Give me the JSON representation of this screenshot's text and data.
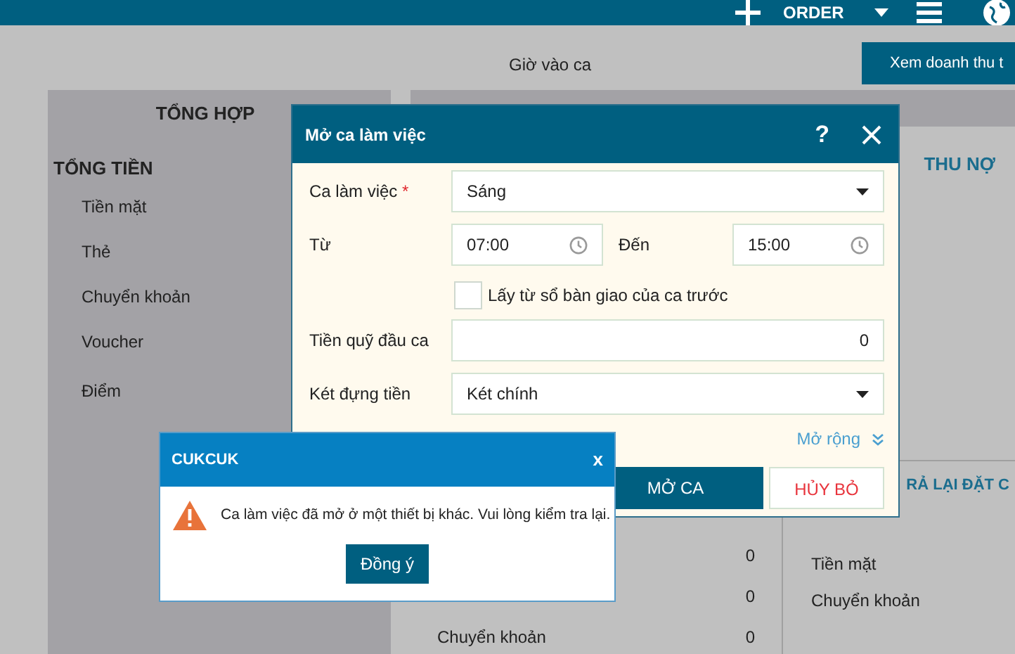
{
  "header": {
    "order_label": "ORDER"
  },
  "shift_time_label": "Giờ vào ca",
  "revenue_button": "Xem doanh thu t",
  "summary": {
    "title": "TỔNG HỢP",
    "total_heading": "TỔNG TIỀN",
    "items": [
      "Tiền mặt",
      "Thẻ",
      "Chuyển khoản",
      "Voucher",
      "Điểm"
    ]
  },
  "right_panel": {
    "debt_heading": "THU NỢ",
    "refund_heading": "RẢ LẠI ĐẶT C",
    "amounts": [
      {
        "value": "0"
      },
      {
        "value": "0"
      },
      {
        "label": "Chuyển khoản",
        "value": "0"
      }
    ],
    "refund_items": [
      "Tiền mặt",
      "Chuyển khoản"
    ]
  },
  "open_shift_dialog": {
    "title": "Mở ca làm việc",
    "help": "?",
    "fields": [
      {
        "kind": "select",
        "label": "Ca làm việc",
        "required_mark": "*",
        "value": "Sáng"
      },
      {
        "kind": "time_range",
        "label": "Từ",
        "value": "07:00",
        "to_label": "Đến",
        "to_value": "15:00"
      },
      {
        "kind": "checkbox",
        "label": "Lấy từ sổ bàn giao của ca trước",
        "checked": false
      },
      {
        "kind": "number",
        "label": "Tiền quỹ đầu ca",
        "value": "0"
      },
      {
        "kind": "select",
        "label": "Két đựng tiền",
        "value": "Két chính"
      }
    ],
    "expand_link": "Mở rộng",
    "buttons": [
      {
        "kind": "primary",
        "label": "MỞ CA"
      },
      {
        "kind": "cancel",
        "label": "HỦY BỎ"
      }
    ]
  },
  "alert": {
    "title": "CUKCUK",
    "close": "x",
    "message": "Ca làm việc đã mở ở một thiết bị khác. Vui lòng kiểm tra lại.",
    "button": "Đồng ý"
  }
}
